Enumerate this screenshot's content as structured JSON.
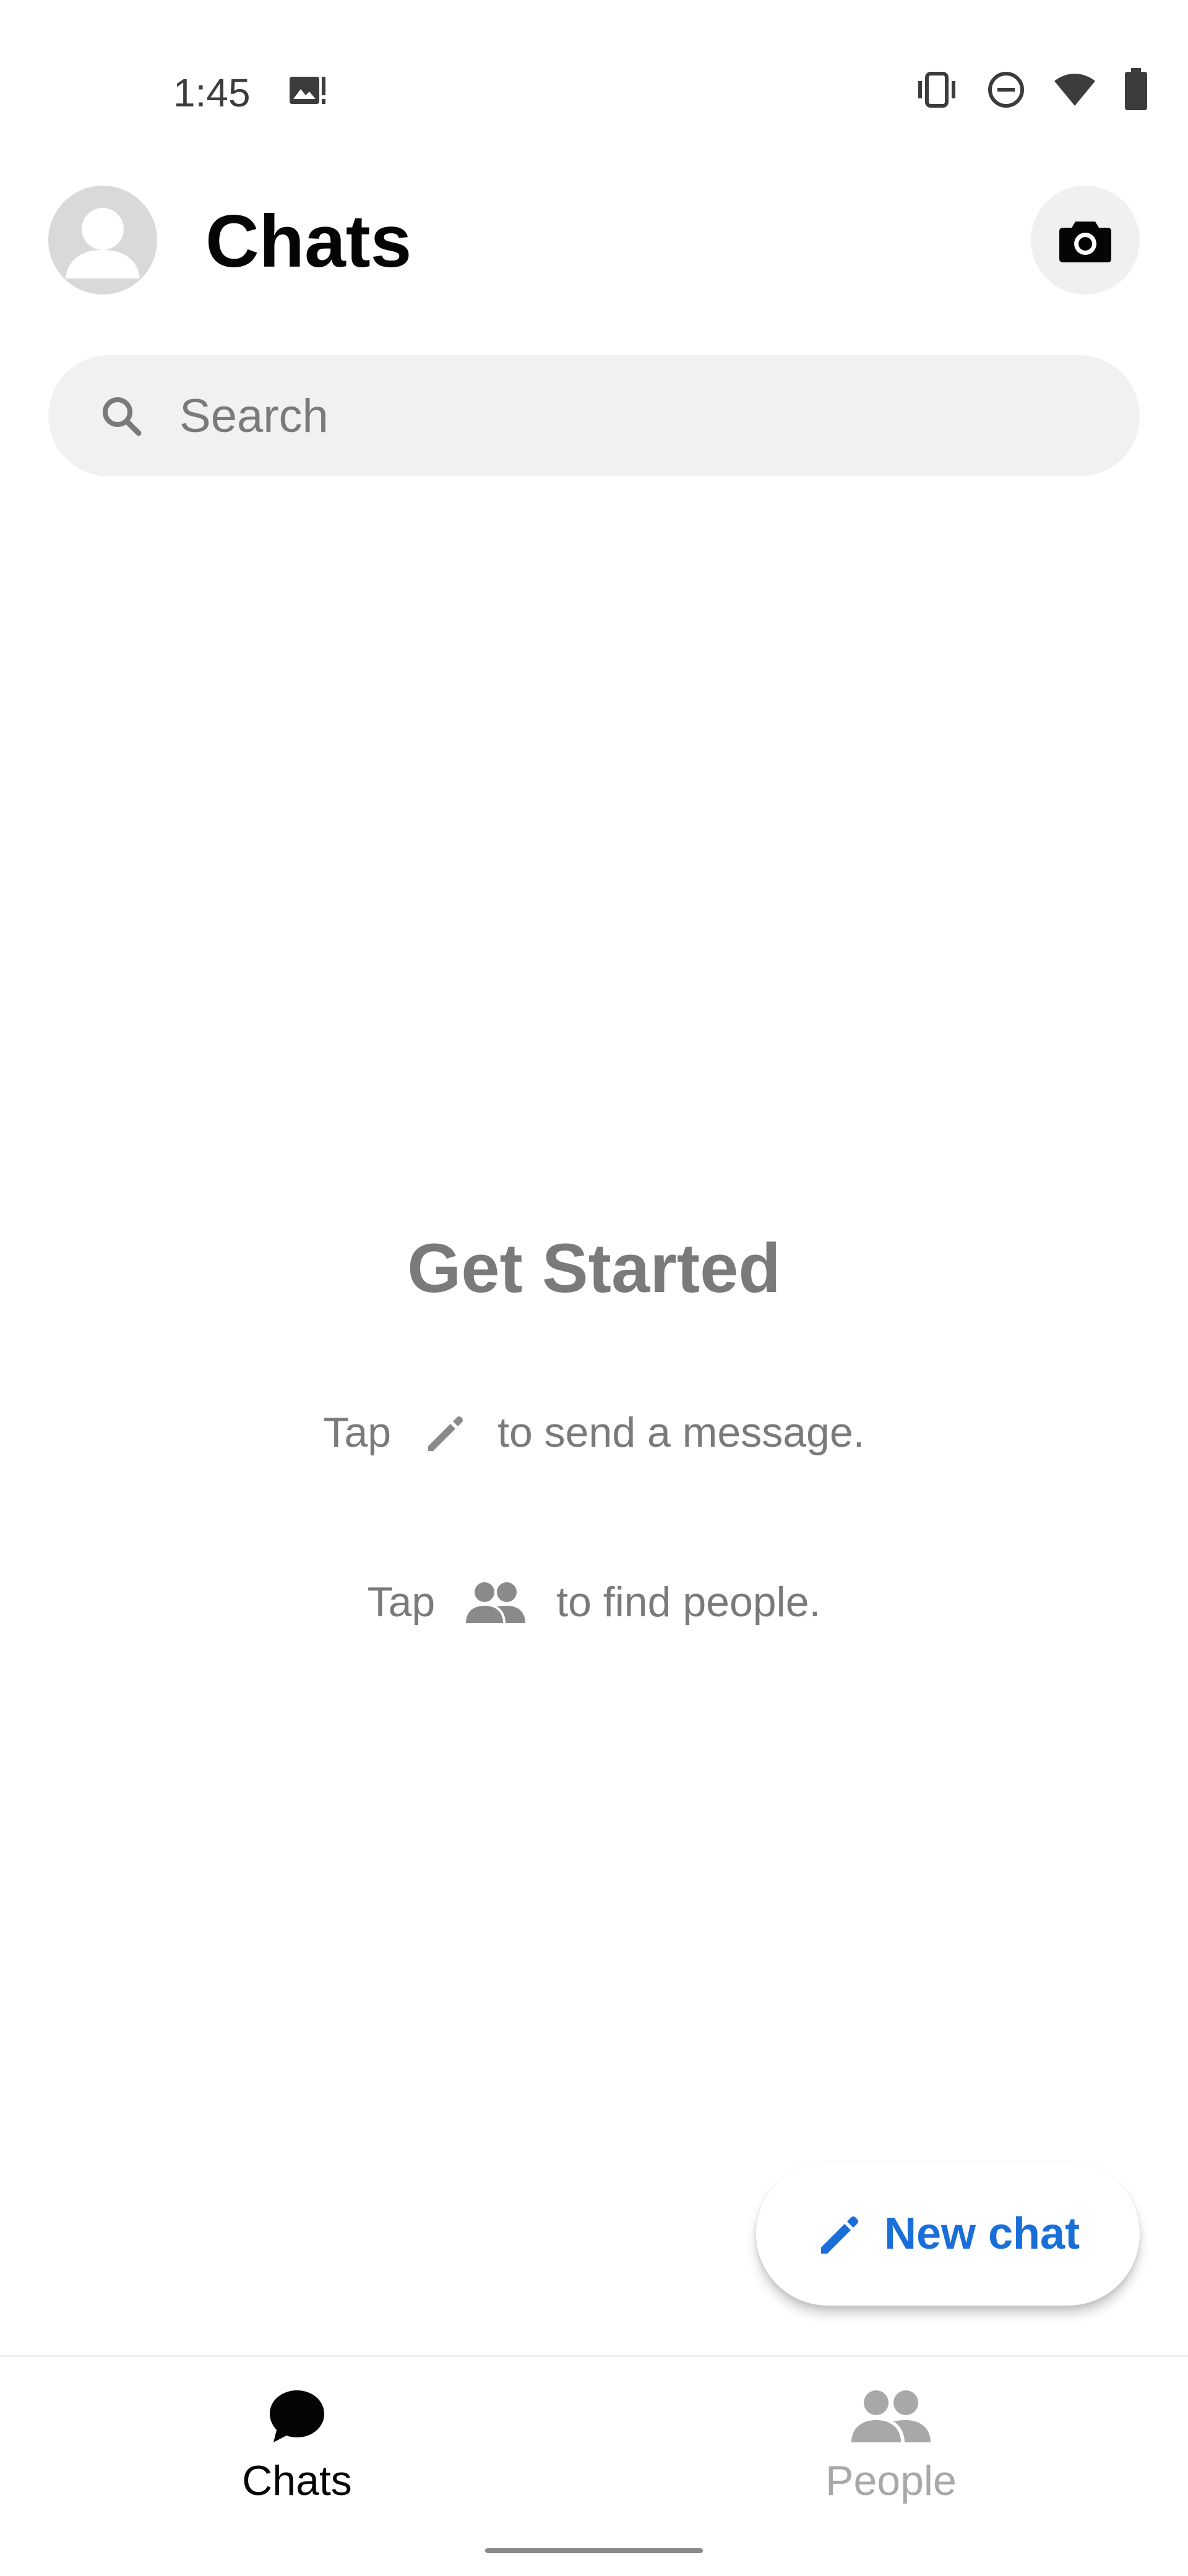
{
  "status_bar": {
    "time": "1:45",
    "icons": [
      "image-alert-icon",
      "vibrate-icon",
      "do-not-disturb-icon",
      "wifi-icon",
      "battery-icon"
    ]
  },
  "header": {
    "title": "Chats",
    "avatar_icon": "avatar-placeholder-icon",
    "camera_icon": "camera-icon"
  },
  "search": {
    "placeholder": "Search",
    "icon": "search-icon"
  },
  "empty_state": {
    "title": "Get Started",
    "hint1_prefix": "Tap",
    "hint1_suffix": "to send a message.",
    "hint1_icon": "pencil-icon",
    "hint2_prefix": "Tap",
    "hint2_suffix": "to find people.",
    "hint2_icon": "people-icon"
  },
  "fab": {
    "label": "New chat",
    "icon": "pencil-icon"
  },
  "bottom_nav": {
    "items": [
      {
        "label": "Chats",
        "icon": "chat-bubble-icon",
        "active": true
      },
      {
        "label": "People",
        "icon": "people-icon",
        "active": false
      }
    ]
  },
  "colors": {
    "accent": "#1a6ed8",
    "text_primary": "#050505",
    "text_secondary": "#7a7a7a",
    "nav_inactive": "#a8a8a8",
    "search_bg": "#f1f1f1"
  }
}
